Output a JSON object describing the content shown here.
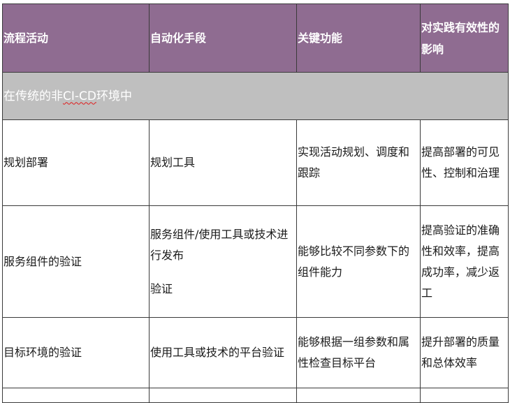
{
  "table": {
    "headers": [
      "流程活动",
      "自动化手段",
      "关键功能",
      "对实践有效性的影响"
    ],
    "section": {
      "prefix": "在传统的非",
      "flagged": "CI-CD",
      "suffix": "环境中"
    },
    "rows": [
      {
        "activity": "规划部署",
        "automation": [
          "规划工具"
        ],
        "function": "实现活动规划、调度和跟踪",
        "impact": "提高部署的可见性、控制和治理"
      },
      {
        "activity": "服务组件的验证",
        "automation": [
          "服务组件/使用工具或技术进行发布",
          "验证"
        ],
        "function": "能够比较不同参数下的组件能力",
        "impact": "提高验证的准确性和效率，提高成功率，减少返工"
      },
      {
        "activity": "目标环境的验证",
        "automation": [
          "使用工具或技术的平台验证"
        ],
        "function": "能够根据一组参数和属性检查目标平台",
        "impact": "提升部署的质量和总体效率"
      }
    ]
  },
  "colors": {
    "header_bg": "#8f6c91",
    "header_text": "#ffffff",
    "section_bg": "#bfbfbf",
    "border": "#3a3a3a"
  }
}
